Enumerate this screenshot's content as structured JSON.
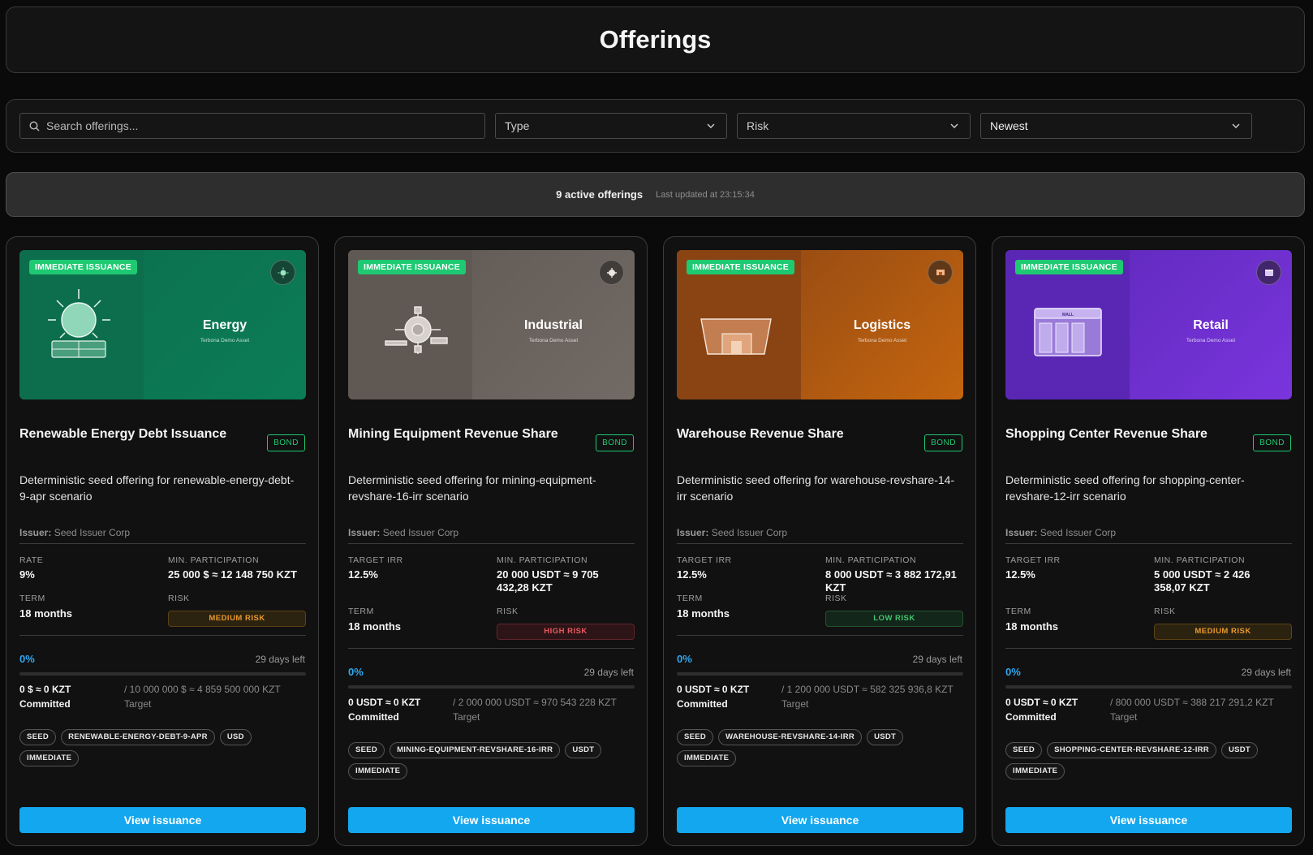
{
  "page": {
    "title": "Offerings"
  },
  "filters": {
    "search_placeholder": "Search offerings...",
    "type_label": "Type",
    "risk_label": "Risk",
    "sort_label": "Newest"
  },
  "status": {
    "count_text": "9 active offerings",
    "updated_text": "Last updated at 23:15:34"
  },
  "cards": [
    {
      "badge": "IMMEDIATE ISSUANCE",
      "sector": "Energy",
      "sector_sub": "Terbona Demo Asset",
      "title": "Renewable Energy Debt Issuance",
      "kind": "BOND",
      "description": "Deterministic seed offering for renewable-energy-debt-9-apr scenario",
      "issuer_label": "Issuer:",
      "issuer": "Seed Issuer Corp",
      "metric_label": "RATE",
      "metric_value": "9%",
      "min_label": "MIN. PARTICIPATION",
      "min_value": "25 000 $ ≈ 12 148 750 KZT",
      "term_label": "TERM",
      "term_value": "18 months",
      "risk_label": "RISK",
      "risk_value": "MEDIUM RISK",
      "progress_pct": "0%",
      "days_left": "29 days left",
      "committed_value": "0 $ ≈ 0 KZT",
      "committed_label": "Committed",
      "target_value": "/ 10 000 000 $ ≈ 4 859 500 000 KZT",
      "target_label": "Target",
      "tags": [
        "SEED",
        "RENEWABLE-ENERGY-DEBT-9-APR",
        "USD",
        "IMMEDIATE"
      ],
      "button": "View issuance",
      "colors": {
        "left": "#0d6e4d",
        "right": "#0b7d56"
      }
    },
    {
      "badge": "IMMEDIATE ISSUANCE",
      "sector": "Industrial",
      "sector_sub": "Terbona Demo Asset",
      "title": "Mining Equipment Revenue Share",
      "kind": "BOND",
      "description": "Deterministic seed offering for mining-equipment-revshare-16-irr scenario",
      "issuer_label": "Issuer:",
      "issuer": "Seed Issuer Corp",
      "metric_label": "TARGET IRR",
      "metric_value": "12.5%",
      "min_label": "MIN. PARTICIPATION",
      "min_value": "20 000 USDT ≈ 9 705 432,28 KZT",
      "term_label": "TERM",
      "term_value": "18 months",
      "risk_label": "RISK",
      "risk_value": "HIGH RISK",
      "progress_pct": "0%",
      "days_left": "29 days left",
      "committed_value": "0 USDT ≈ 0 KZT",
      "committed_label": "Committed",
      "target_value": "/ 2 000 000 USDT ≈ 970 543 228 KZT",
      "target_label": "Target",
      "tags": [
        "SEED",
        "MINING-EQUIPMENT-REVSHARE-16-IRR",
        "USDT",
        "IMMEDIATE"
      ],
      "button": "View issuance",
      "colors": {
        "left": "#5f5853",
        "right": "#726a64"
      }
    },
    {
      "badge": "IMMEDIATE ISSUANCE",
      "sector": "Logistics",
      "sector_sub": "Terbona Demo Asset",
      "title": "Warehouse Revenue Share",
      "kind": "BOND",
      "description": "Deterministic seed offering for warehouse-revshare-14-irr scenario",
      "issuer_label": "Issuer:",
      "issuer": "Seed Issuer Corp",
      "metric_label": "TARGET IRR",
      "metric_value": "12.5%",
      "min_label": "MIN. PARTICIPATION",
      "min_value": "8 000 USDT ≈ 3 882 172,91 KZT",
      "term_label": "TERM",
      "term_value": "18 months",
      "risk_label": "RISK",
      "risk_value": "LOW RISK",
      "progress_pct": "0%",
      "days_left": "29 days left",
      "committed_value": "0 USDT ≈ 0 KZT",
      "committed_label": "Committed",
      "target_value": "/ 1 200 000 USDT ≈ 582 325 936,8 KZT",
      "target_label": "Target",
      "tags": [
        "SEED",
        "WAREHOUSE-REVSHARE-14-IRR",
        "USDT",
        "IMMEDIATE"
      ],
      "button": "View issuance",
      "colors": {
        "left": "#8a4414",
        "right": "#c4650f"
      }
    },
    {
      "badge": "IMMEDIATE ISSUANCE",
      "sector": "Retail",
      "sector_sub": "Terbona Demo Asset",
      "title": "Shopping Center Revenue Share",
      "kind": "BOND",
      "description": "Deterministic seed offering for shopping-center-revshare-12-irr scenario",
      "issuer_label": "Issuer:",
      "issuer": "Seed Issuer Corp",
      "metric_label": "TARGET IRR",
      "metric_value": "12.5%",
      "min_label": "MIN. PARTICIPATION",
      "min_value": "5 000 USDT ≈ 2 426 358,07 KZT",
      "term_label": "TERM",
      "term_value": "18 months",
      "risk_label": "RISK",
      "risk_value": "MEDIUM RISK",
      "progress_pct": "0%",
      "days_left": "29 days left",
      "committed_value": "0 USDT ≈ 0 KZT",
      "committed_label": "Committed",
      "target_value": "/ 800 000 USDT ≈ 388 217 291,2 KZT",
      "target_label": "Target",
      "tags": [
        "SEED",
        "SHOPPING-CENTER-REVSHARE-12-IRR",
        "USDT",
        "IMMEDIATE"
      ],
      "button": "View issuance",
      "colors": {
        "left": "#5a27b5",
        "right": "#7a35dd"
      }
    }
  ],
  "illustration_labels": {
    "mall_sign": "MALL"
  }
}
